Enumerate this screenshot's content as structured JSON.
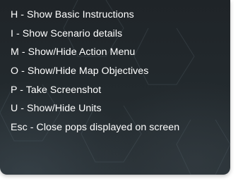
{
  "shortcuts": [
    {
      "text": "H - Show Basic Instructions"
    },
    {
      "text": "I - Show Scenario details"
    },
    {
      "text": "M - Show/Hide Action Menu"
    },
    {
      "text": "O - Show/Hide Map Objectives"
    },
    {
      "text": "P - Take Screenshot"
    },
    {
      "text": "U - Show/Hide Units"
    },
    {
      "text": "Esc - Close pops displayed on screen"
    }
  ],
  "colors": {
    "panel_background": "#1f2428",
    "text": "#ffffff"
  }
}
